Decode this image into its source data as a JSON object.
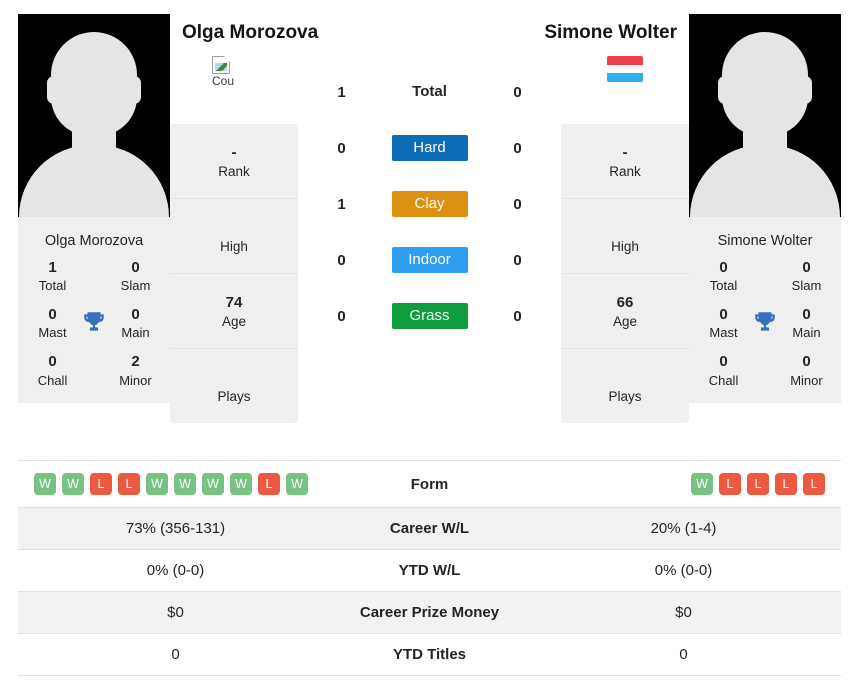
{
  "players": {
    "left": {
      "name": "Olga Morozova",
      "card_name": "Olga Morozova",
      "flag": {
        "type": "broken-image",
        "alt_text": "Cou",
        "icon": "broken-image-icon"
      },
      "avatar": "player-silhouette-avatar",
      "titles": [
        {
          "value": "1",
          "label": "Total"
        },
        {
          "value": "0",
          "label": "Slam"
        },
        {
          "value": "0",
          "label": "Mast"
        },
        {
          "value": "0",
          "label": "Main"
        },
        {
          "value": "0",
          "label": "Chall"
        },
        {
          "value": "2",
          "label": "Minor"
        }
      ],
      "info": [
        {
          "value": "-",
          "label": "Rank"
        },
        {
          "value": "",
          "label": "High"
        },
        {
          "value": "74",
          "label": "Age"
        },
        {
          "value": "",
          "label": "Plays"
        }
      ],
      "form": [
        "W",
        "W",
        "L",
        "L",
        "W",
        "W",
        "W",
        "W",
        "L",
        "W"
      ],
      "career_wl": "73% (356-131)",
      "ytd_wl": "0% (0-0)",
      "career_prize_money": "$0",
      "ytd_titles": "0"
    },
    "right": {
      "name": "Simone Wolter",
      "card_name": "Simone Wolter",
      "flag": {
        "type": "flag",
        "alt_text": "Luxembourg",
        "icon": "luxembourg-flag-icon"
      },
      "avatar": "player-silhouette-avatar",
      "titles": [
        {
          "value": "0",
          "label": "Total"
        },
        {
          "value": "0",
          "label": "Slam"
        },
        {
          "value": "0",
          "label": "Mast"
        },
        {
          "value": "0",
          "label": "Main"
        },
        {
          "value": "0",
          "label": "Chall"
        },
        {
          "value": "0",
          "label": "Minor"
        }
      ],
      "info": [
        {
          "value": "-",
          "label": "Rank"
        },
        {
          "value": "",
          "label": "High"
        },
        {
          "value": "66",
          "label": "Age"
        },
        {
          "value": "",
          "label": "Plays"
        }
      ],
      "form": [
        "W",
        "L",
        "L",
        "L",
        "L"
      ],
      "career_wl": "20% (1-4)",
      "ytd_wl": "0% (0-0)",
      "career_prize_money": "$0",
      "ytd_titles": "0"
    }
  },
  "h2h": [
    {
      "left": "1",
      "label": "Total",
      "right": "0",
      "style": "plain",
      "color": ""
    },
    {
      "left": "0",
      "label": "Hard",
      "right": "0",
      "style": "badge",
      "color": "#0b6cb8"
    },
    {
      "left": "1",
      "label": "Clay",
      "right": "0",
      "style": "badge",
      "color": "#dd9110"
    },
    {
      "left": "0",
      "label": "Indoor",
      "right": "0",
      "style": "badge",
      "color": "#2e9ff0"
    },
    {
      "left": "0",
      "label": "Grass",
      "right": "0",
      "style": "badge",
      "color": "#0f9d3e"
    }
  ],
  "comparison_rows": [
    {
      "label": "Form",
      "kind": "form",
      "left": "",
      "right": ""
    },
    {
      "label": "Career W/L",
      "kind": "text",
      "left": "73% (356-131)",
      "right": "20% (1-4)"
    },
    {
      "label": "YTD W/L",
      "kind": "text",
      "left": "0% (0-0)",
      "right": "0% (0-0)"
    },
    {
      "label": "Career Prize Money",
      "kind": "text",
      "left": "$0",
      "right": "$0"
    },
    {
      "label": "YTD Titles",
      "kind": "text",
      "left": "0",
      "right": "0"
    }
  ],
  "colors": {
    "hard": "#0b6cb8",
    "clay": "#dd9110",
    "indoor": "#2e9ff0",
    "grass": "#0f9d3e",
    "win_badge": "#78c283",
    "loss_badge": "#ed5840",
    "trophy": "#3b6fb6",
    "card_bg": "#efefef",
    "stripe_bg": "#f2f2f2"
  }
}
